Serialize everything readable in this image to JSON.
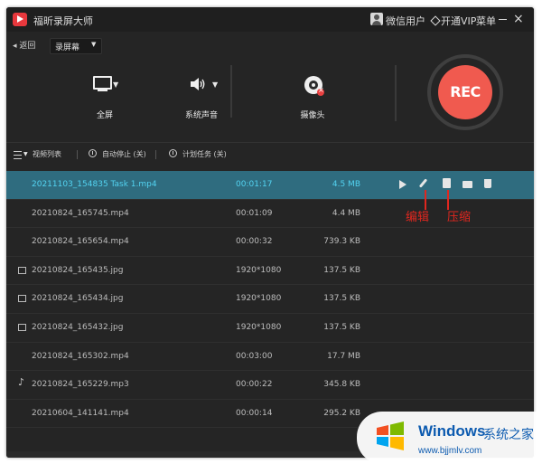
{
  "app": {
    "title": "福昕录屏大师",
    "user": "微信用户",
    "vip": "开通VIP",
    "menu": "菜单"
  },
  "toolbar": {
    "back": "◂ 返回",
    "mode": "录屏幕"
  },
  "sources": {
    "screen": "全屏",
    "audio": "系统声音",
    "camera": "摄像头"
  },
  "record": {
    "label": "REC",
    "color": "#f05a4f"
  },
  "listbar": {
    "list": "视频列表",
    "auto_stop": "自动停止 (关)",
    "schedule": "计划任务 (关)"
  },
  "files": [
    {
      "name": "20211103_154835 Task 1.mp4",
      "duration": "00:01:17",
      "size": "4.5 MB",
      "icon": "video",
      "selected": true
    },
    {
      "name": "20210824_165745.mp4",
      "duration": "00:01:09",
      "size": "4.4 MB",
      "icon": "video"
    },
    {
      "name": "20210824_165654.mp4",
      "duration": "00:00:32",
      "size": "739.3 KB",
      "icon": "video"
    },
    {
      "name": "20210824_165435.jpg",
      "duration": "1920*1080",
      "size": "137.5 KB",
      "icon": "image"
    },
    {
      "name": "20210824_165434.jpg",
      "duration": "1920*1080",
      "size": "137.5 KB",
      "icon": "image"
    },
    {
      "name": "20210824_165432.jpg",
      "duration": "1920*1080",
      "size": "137.5 KB",
      "icon": "image"
    },
    {
      "name": "20210824_165302.mp4",
      "duration": "00:03:00",
      "size": "17.7 MB",
      "icon": "video"
    },
    {
      "name": "20210824_165229.mp3",
      "duration": "00:00:22",
      "size": "345.8 KB",
      "icon": "audio"
    },
    {
      "name": "20210604_141141.mp4",
      "duration": "00:00:14",
      "size": "295.2 KB",
      "icon": "video"
    }
  ],
  "annotations": {
    "edit": "编辑",
    "compress": "压缩"
  },
  "watermark": {
    "title": "Windows",
    "subtitle": "系统之家",
    "url": "www.bjjmlv.com"
  },
  "colors": {
    "selected_row": "#2f6c7f",
    "selected_text": "#53d3f1",
    "annotation": "#e0271f"
  }
}
